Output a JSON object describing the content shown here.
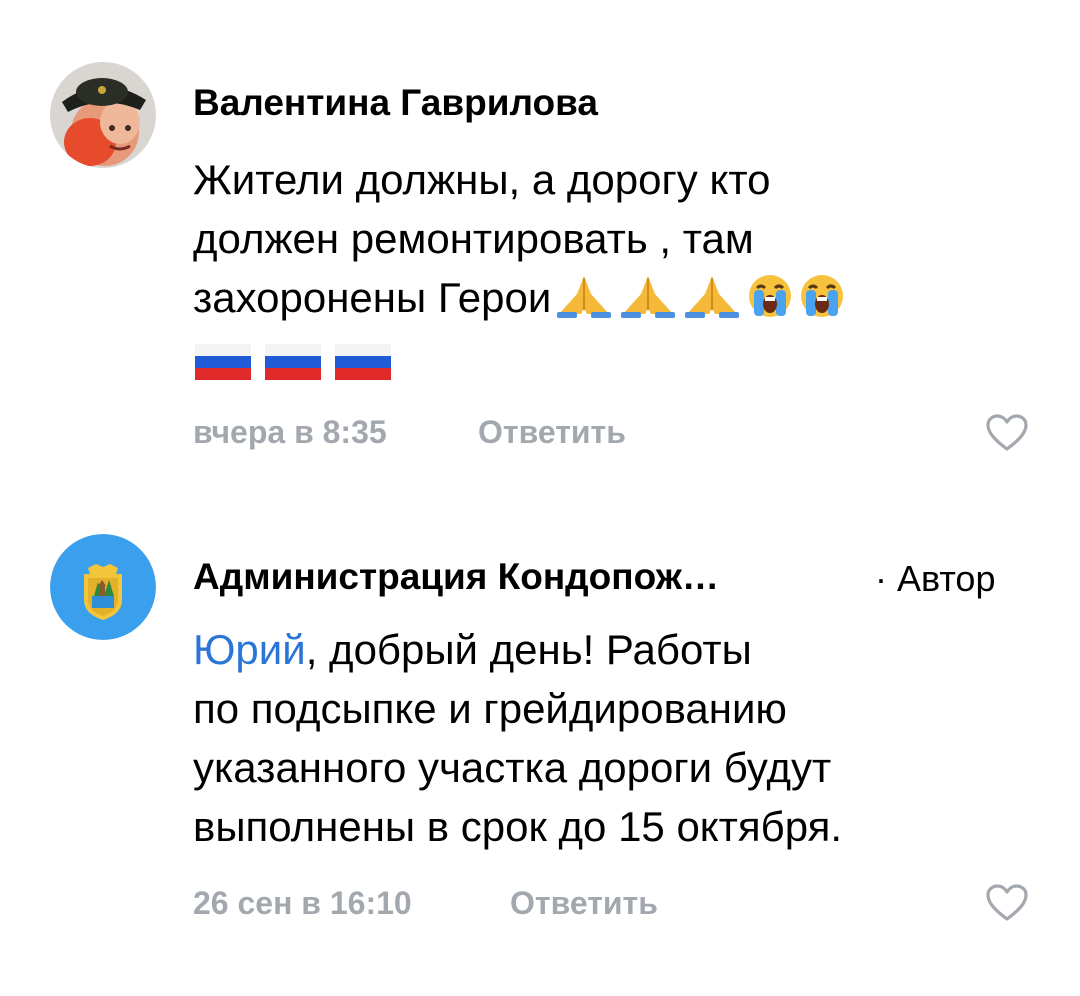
{
  "comments": [
    {
      "author": "Валентина Гаврилова",
      "avatar_icon": "user-photo-avatar",
      "text_lines": [
        "Жители должны, а дорогу кто",
        "должен ремонтировать , там",
        "захоронены Герои"
      ],
      "trailing_emojis": [
        "folded-hands",
        "folded-hands",
        "folded-hands",
        "crying-face",
        "crying-face"
      ],
      "flags": [
        "russia-flag",
        "russia-flag",
        "russia-flag"
      ],
      "time": "вчера в 8:35",
      "reply_label": "Ответить",
      "like_icon": "heart-outline-icon"
    },
    {
      "author": "Администрация Кондопож…",
      "author_tag": "· Автор",
      "avatar_icon": "coat-of-arms-avatar",
      "mention": "Юрий",
      "text_first_rest": ", добрый день! Работы",
      "text_lines": [
        "по подсыпке и грейдированию",
        "указанного участка дороги будут",
        "выполнены в срок до 15 октября."
      ],
      "time": "26 сен в 16:10",
      "reply_label": "Ответить",
      "like_icon": "heart-outline-icon"
    }
  ],
  "colors": {
    "meta_gray": "#a3a8ae",
    "mention_blue": "#2a75d6",
    "admin_avatar_bg": "#3aa0ee"
  }
}
